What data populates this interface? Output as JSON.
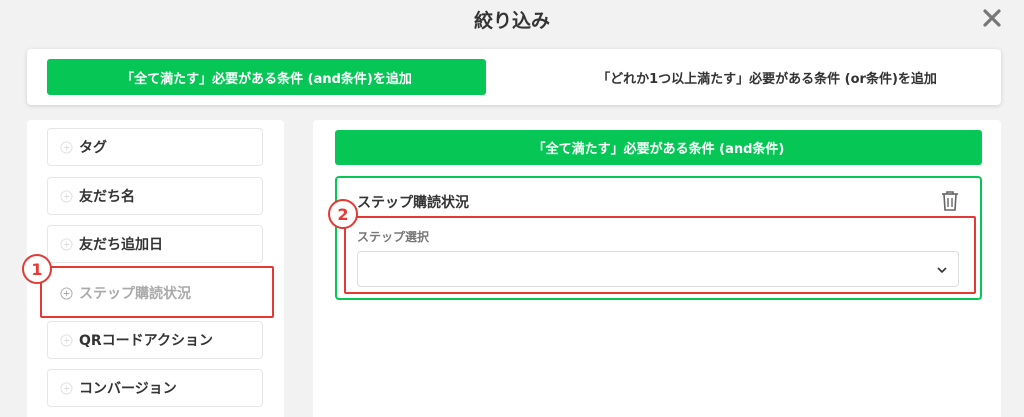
{
  "dialog": {
    "title": "絞り込み"
  },
  "tabs": {
    "and_label": "「全て満たす」必要がある条件 (and条件)を追加",
    "or_label": "「どれか1つ以上満たす」必要がある条件 (or条件)を追加"
  },
  "condition_types": [
    {
      "label": "タグ"
    },
    {
      "label": "友だち名"
    },
    {
      "label": "友だち追加日"
    },
    {
      "label": "ステップ購読状況"
    },
    {
      "label": "QRコードアクション"
    },
    {
      "label": "コンバージョン"
    }
  ],
  "right": {
    "and_header": "「全て満たす」必要がある条件 (and条件)",
    "condition": {
      "title": "ステップ購読状況",
      "step_label": "ステップ選択",
      "step_value": ""
    }
  },
  "annotations": [
    {
      "number": "1"
    },
    {
      "number": "2"
    }
  ],
  "colors": {
    "accent": "#06c755",
    "highlight": "#e53935"
  }
}
